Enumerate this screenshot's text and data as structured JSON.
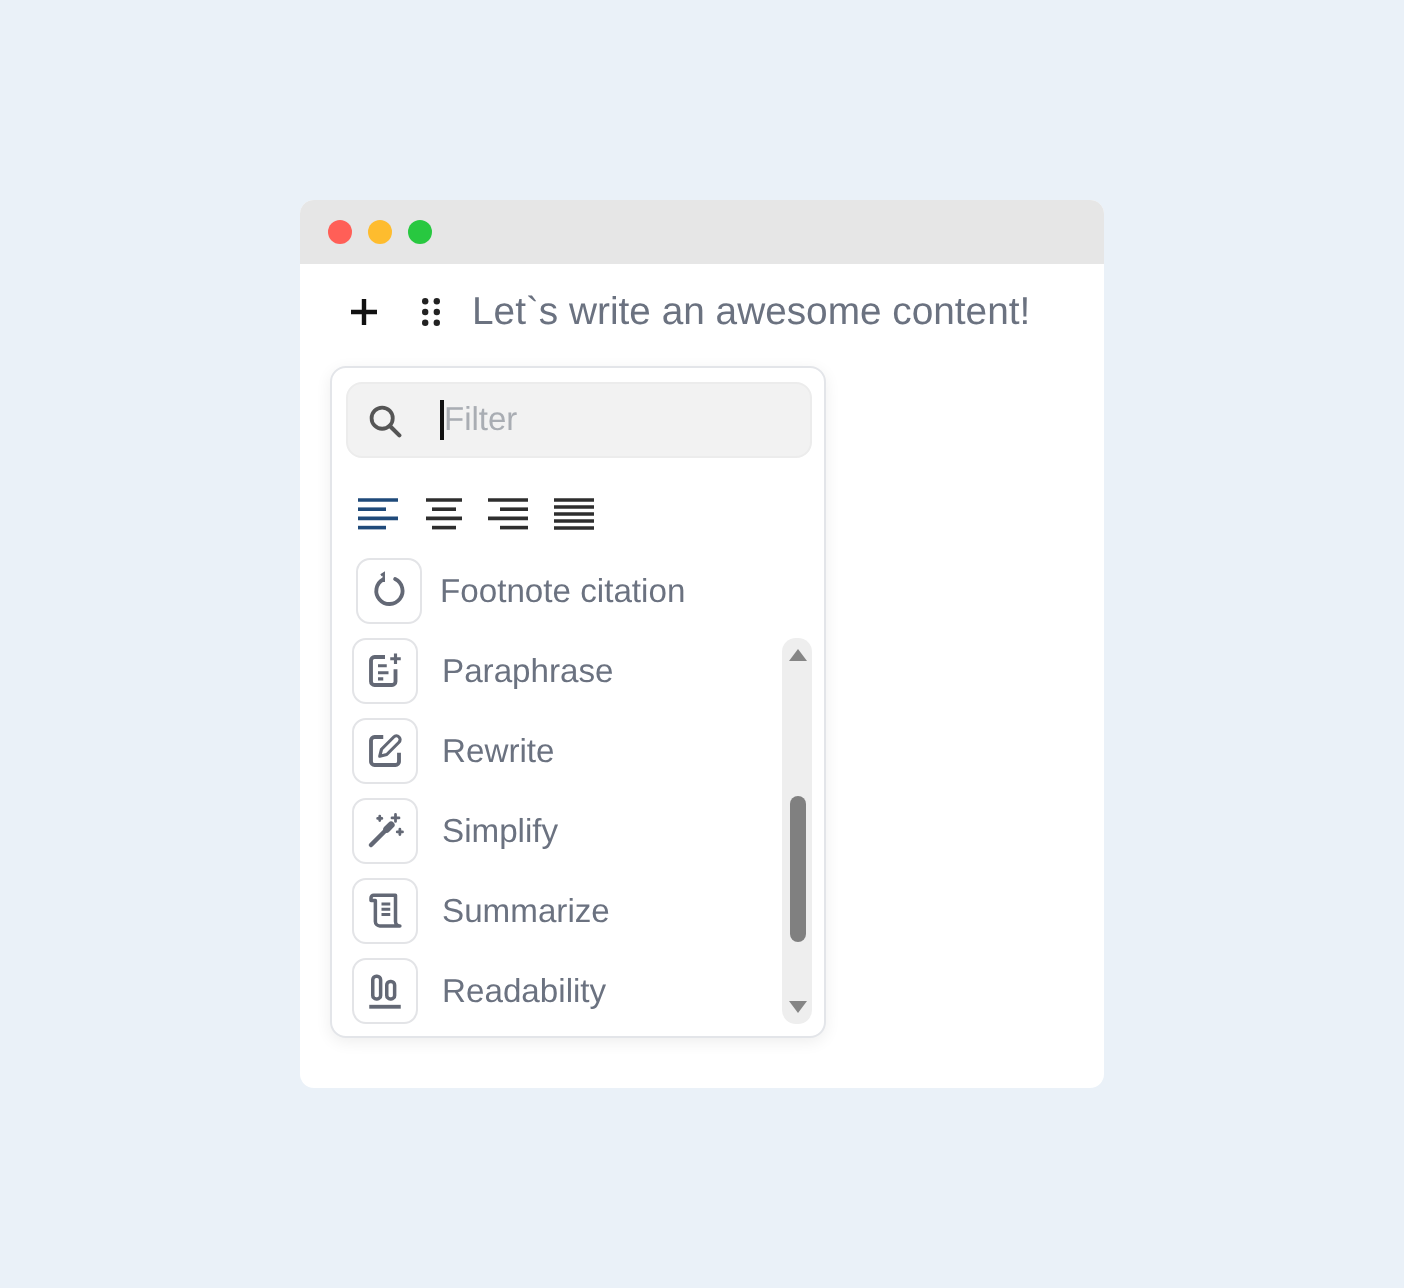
{
  "window": {
    "controls": [
      {
        "color": "#ff5f57"
      },
      {
        "color": "#febc2e"
      },
      {
        "color": "#28c840"
      }
    ]
  },
  "editor": {
    "placeholder": "Let`s write an awesome content!"
  },
  "menu": {
    "search": {
      "placeholder": "Filter",
      "focused": true
    },
    "alignment": [
      {
        "kind": "left",
        "selected": true
      },
      {
        "kind": "center",
        "selected": false
      },
      {
        "kind": "right",
        "selected": false
      },
      {
        "kind": "justify",
        "selected": false
      }
    ],
    "pinned_item": {
      "kind": "footnote",
      "label": "Footnote citation"
    },
    "items": [
      {
        "kind": "paraphrase",
        "label": "Paraphrase"
      },
      {
        "kind": "rewrite",
        "label": "Rewrite"
      },
      {
        "kind": "simplify",
        "label": "Simplify"
      },
      {
        "kind": "summarize",
        "label": "Summarize"
      },
      {
        "kind": "readability",
        "label": "Readability"
      }
    ]
  }
}
